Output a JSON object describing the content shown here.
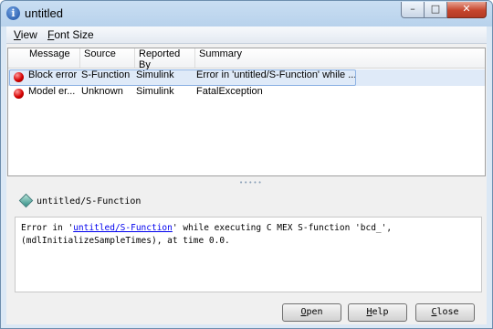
{
  "window": {
    "title": "untitled",
    "icon": "info-icon",
    "controls": {
      "minimize": "minimize-icon",
      "maximize": "maximize-icon",
      "close": "close-icon"
    }
  },
  "menu": [
    {
      "label": "View",
      "mnemonic": "V",
      "rest": "iew"
    },
    {
      "label": "Font Size",
      "mnemonic": "F",
      "rest": "ont Size"
    }
  ],
  "table": {
    "columns": [
      "Message",
      "Source",
      "Reported By",
      "Summary"
    ],
    "rows": [
      {
        "icon": "error-icon",
        "message": "Block error",
        "source": "S-Function",
        "reported_by": "Simulink",
        "summary": "Error in 'untitled/S-Function' while ...",
        "selected": true
      },
      {
        "icon": "error-icon",
        "message": "Model er...",
        "source": "Unknown",
        "reported_by": "Simulink",
        "summary": "FatalException",
        "selected": false
      }
    ]
  },
  "detail": {
    "path": "untitled/S-Function",
    "path_icon": "block-diamond-icon",
    "text_before": "Error in '",
    "link": "untitled/S-Function",
    "text_after": "' while executing C MEX S-function 'bcd_',",
    "line2": "(mdlInitializeSampleTimes), at time 0.0."
  },
  "buttons": {
    "open": {
      "mnemonic": "O",
      "rest": "pen"
    },
    "help": {
      "mnemonic": "H",
      "rest": "elp"
    },
    "close": {
      "mnemonic": "C",
      "rest": "lose"
    }
  },
  "colors": {
    "selection": "#dfeaf8",
    "error": "#d50000",
    "link": "#0000ee"
  }
}
